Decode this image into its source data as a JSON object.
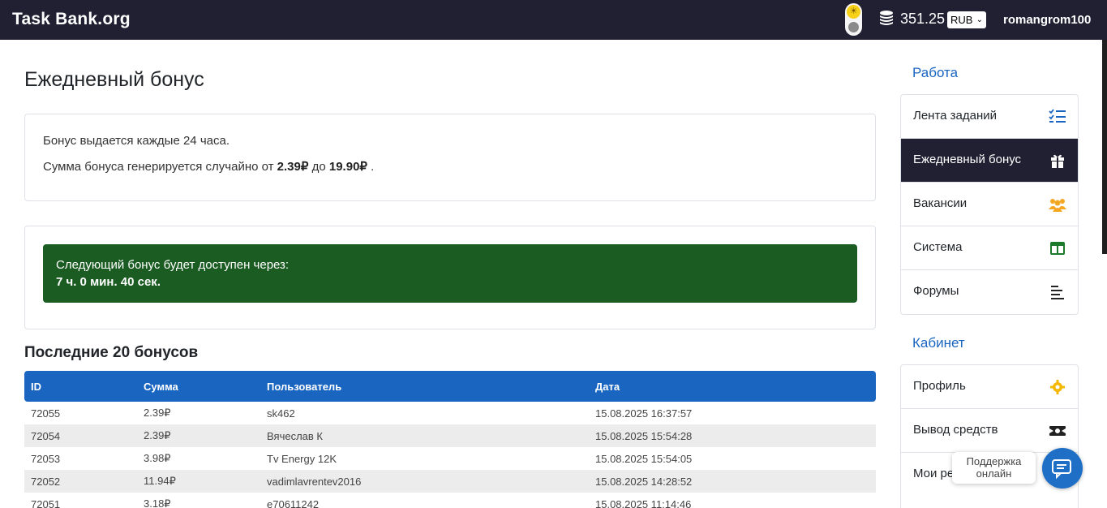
{
  "header": {
    "brand": "Task Bank.org",
    "balance": "351.25",
    "currency": "RUB",
    "username": "romangrom100",
    "icons": [
      "sun-icon",
      "coins-icon",
      "chevron-down-icon"
    ]
  },
  "main": {
    "title": "Ежедневный бонус",
    "info": {
      "line1": "Бонус выдается каждые 24 часа.",
      "line2_prefix": "Сумма бонуса генерируется случайно от",
      "min_amount": "2.39₽",
      "line2_mid": "до",
      "max_amount": "19.90₽",
      "line2_suffix": "."
    },
    "timer": {
      "label": "Следующий бонус будет доступен через:",
      "value": "7 ч. 0 мин. 40 сек."
    },
    "recent_title": "Последние 20 бонусов",
    "table": {
      "headers": [
        "ID",
        "Сумма",
        "Пользователь",
        "Дата"
      ],
      "rows": [
        [
          "72055",
          "2.39₽",
          "sk462",
          "15.08.2025 16:37:57"
        ],
        [
          "72054",
          "2.39₽",
          "Вячеслав К",
          "15.08.2025 15:54:28"
        ],
        [
          "72053",
          "3.98₽",
          "Tv Energy 12K",
          "15.08.2025 15:54:05"
        ],
        [
          "72052",
          "11.94₽",
          "vadimlavrentev2016",
          "15.08.2025 14:28:52"
        ],
        [
          "72051",
          "3.18₽",
          "e70611242",
          "15.08.2025 11:14:46"
        ]
      ]
    }
  },
  "sidebar": {
    "work_heading": "Работа",
    "work_items": [
      {
        "label": "Лента заданий",
        "icon": "task-list-icon",
        "color": "#1965c0"
      },
      {
        "label": "Ежедневный бонус",
        "icon": "gift-icon",
        "color": "#ffffff",
        "active": true
      },
      {
        "label": "Вакансии",
        "icon": "users-icon",
        "color": "#f5a623"
      },
      {
        "label": "Система",
        "icon": "layout-icon",
        "color": "#1a7a2a"
      },
      {
        "label": "Форумы",
        "icon": "align-left-icon",
        "color": "#222222"
      }
    ],
    "cabinet_heading": "Кабинет",
    "cabinet_items": [
      {
        "label": "Профиль",
        "icon": "gear-icon",
        "color": "#f5b800"
      },
      {
        "label": "Вывод средств",
        "icon": "money-icon",
        "color": "#222222"
      },
      {
        "label": "Мои ре",
        "icon": "",
        "color": ""
      }
    ]
  },
  "support": {
    "text_line1": "Поддержка",
    "text_line2": "онлайн",
    "icon": "chat-icon"
  },
  "colors": {
    "header_bg": "#212033",
    "accent": "#1965c0",
    "alert_bg": "#1a5c22"
  }
}
